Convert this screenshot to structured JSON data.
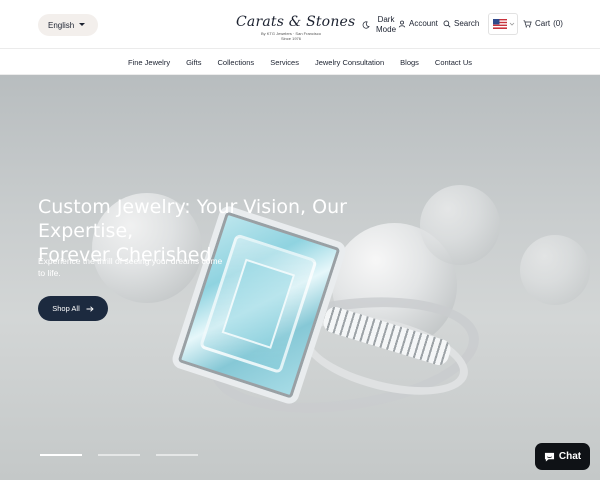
{
  "header": {
    "language": "English",
    "logo": {
      "main": "Carats & Stones",
      "sub": "By KTG Jewelers · San Francisco",
      "since": "Since 1976"
    },
    "dark_mode": [
      "Dark",
      "Mode"
    ],
    "account": "Account",
    "search": "Search",
    "cart_label": "Cart",
    "cart_count": "(0)"
  },
  "nav": {
    "items": [
      "Fine Jewelry",
      "Gifts",
      "Collections",
      "Services",
      "Jewelry Consultation",
      "Blogs",
      "Contact Us"
    ]
  },
  "hero": {
    "title_line1": "Custom Jewelry: Your Vision, Our Expertise,",
    "title_line2": "Forever Cherished",
    "subtitle_line1": "Experience the thrill of seeing your dreams come",
    "subtitle_line2": "to life.",
    "cta": "Shop All"
  },
  "chat": {
    "label": "Chat"
  },
  "colors": {
    "accent": "#1c2a3f",
    "chat_bg": "#0f1216",
    "lang_bg": "#f3efec"
  },
  "icons": [
    "moon-icon",
    "user-icon",
    "search-icon",
    "us-flag-icon",
    "cart-icon",
    "arrow-right-icon",
    "chat-bubble-icon"
  ]
}
